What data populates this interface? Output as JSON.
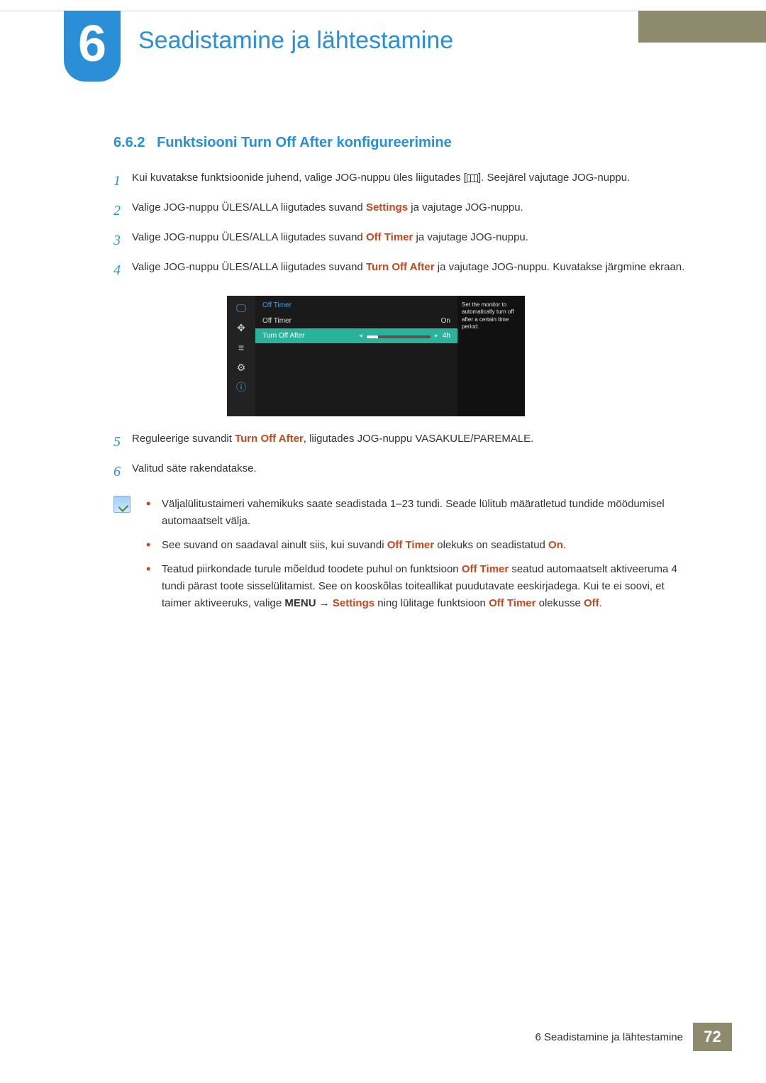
{
  "chapter": {
    "number": "6",
    "title": "Seadistamine ja lähtestamine"
  },
  "section": {
    "number": "6.6.2",
    "title": "Funktsiooni Turn Off After konfigureerimine"
  },
  "steps": [
    {
      "num": "1",
      "pre": "Kui kuvatakse funktsioonide juhend, valige JOG-nuppu üles liigutades [",
      "post": "]. Seejärel vajutage JOG-nuppu."
    },
    {
      "num": "2",
      "pre": "Valige JOG-nuppu ÜLES/ALLA liigutades suvand ",
      "hl": "Settings",
      "post": " ja vajutage JOG-nuppu."
    },
    {
      "num": "3",
      "pre": "Valige JOG-nuppu ÜLES/ALLA liigutades suvand ",
      "hl": "Off Timer",
      "post": " ja vajutage JOG-nuppu."
    },
    {
      "num": "4",
      "pre": "Valige JOG-nuppu ÜLES/ALLA liigutades suvand ",
      "hl": "Turn Off After",
      "post": " ja vajutage JOG-nuppu. Kuvatakse järgmine ekraan."
    },
    {
      "num": "5",
      "pre": "Reguleerige suvandit ",
      "hl": "Turn Off After",
      "post": ", liigutades JOG-nuppu VASAKULE/PAREMALE."
    },
    {
      "num": "6",
      "pre": "Valitud säte rakendatakse."
    }
  ],
  "osd": {
    "header": "Off Timer",
    "row1": {
      "label": "Off Timer",
      "value": "On"
    },
    "row2": {
      "label": "Turn Off After",
      "value": "4h"
    },
    "hint": "Set the monitor to automatically turn off after a certain time period."
  },
  "notes": [
    "Väljalülitustaimeri vahemikuks saate seadistada 1–23 tundi. Seade lülitub määratletud tundide möödumisel automaatselt välja.",
    {
      "parts": [
        "See suvand on saadaval ainult siis, kui suvandi ",
        {
          "hl": "Off Timer"
        },
        " olekuks on seadistatud ",
        {
          "hl": "On"
        },
        "."
      ]
    },
    {
      "parts": [
        "Teatud piirkondade turule mõeldud toodete puhul on funktsioon ",
        {
          "hl": "Off Timer"
        },
        " seatud automaatselt aktiveeruma 4 tundi pärast toote sisselülitamist. See on kooskõlas toiteallikat puudutavate eeskirjadega. Kui te ei soovi, et taimer aktiveeruks, valige ",
        {
          "b": "MENU"
        },
        "  →  ",
        {
          "hl": "Settings"
        },
        " ning lülitage funktsioon ",
        {
          "hl": "Off Timer"
        },
        " olekusse ",
        {
          "hl": "Off"
        },
        "."
      ]
    }
  ],
  "footer": {
    "text": "6 Seadistamine ja lähtestamine",
    "page": "72"
  }
}
